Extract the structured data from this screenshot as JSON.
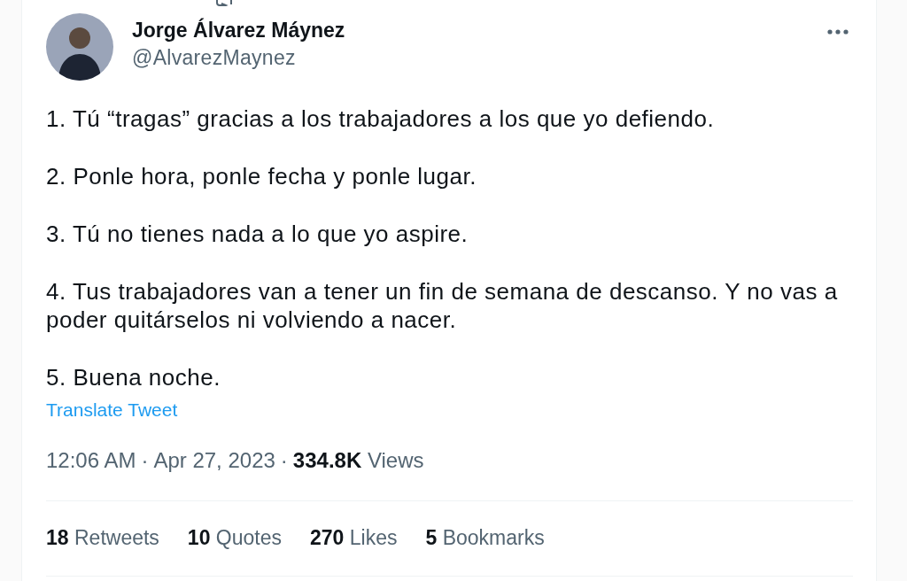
{
  "tweet": {
    "author": {
      "name": "Jorge Álvarez Máynez",
      "handle": "@AlvarezMaynez"
    },
    "paragraphs": [
      "1. Tú “tragas” gracias a los trabajadores a los que yo defiendo.",
      "2. Ponle hora, ponle fecha y ponle lugar.",
      "3. Tú no tienes nada a lo que yo aspire.",
      "4. Tus trabajadores van a tener un fin de semana de descanso. Y no vas a poder quitárselos ni volviendo a nacer.",
      "5. Buena noche."
    ],
    "translate_link": "Translate Tweet",
    "time": "12:06 AM",
    "separator": "·",
    "date": "Apr 27, 2023",
    "views": {
      "count": "334.8K",
      "label": "Views"
    },
    "stats": [
      {
        "count": "18",
        "label": "Retweets"
      },
      {
        "count": "10",
        "label": "Quotes"
      },
      {
        "count": "270",
        "label": "Likes"
      },
      {
        "count": "5",
        "label": "Bookmarks"
      }
    ]
  }
}
